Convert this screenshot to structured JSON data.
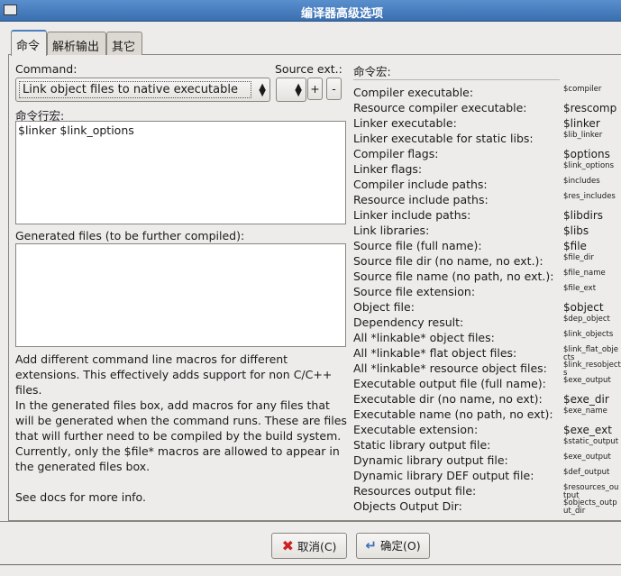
{
  "window": {
    "title": "编译器高级选项"
  },
  "tabs": [
    {
      "label": "命令"
    },
    {
      "label": "解析输出"
    },
    {
      "label": "其它"
    }
  ],
  "command": {
    "label": "Command:",
    "selected": "Link object files to native executable"
  },
  "source_ext": {
    "label": "Source ext.:",
    "add": "+",
    "remove": "-"
  },
  "macro_line": {
    "label": "命令行宏:",
    "value": "$linker $link_options"
  },
  "generated": {
    "label": "Generated files (to be further compiled):",
    "value": ""
  },
  "help": [
    "Add different command line macros for different extensions. This effectively adds support for non C/C++ files.",
    "In the generated files box, add macros for any files that will be generated when the command runs. These are files that will further need to be compiled by the build system.",
    "Currently, only the $file* macros are allowed to appear in the generated files box.",
    "",
    "See docs for more info."
  ],
  "macros": {
    "title": "命令宏:",
    "rows": [
      [
        "Compiler executable:",
        "$compiler"
      ],
      [
        "Resource compiler executable:",
        "$rescomp"
      ],
      [
        "Linker executable:",
        "$linker"
      ],
      [
        "Linker executable for static libs:",
        "$lib_linker"
      ],
      [
        "Compiler flags:",
        "$options"
      ],
      [
        "Linker flags:",
        "$link_options"
      ],
      [
        "Compiler include paths:",
        "$includes"
      ],
      [
        "Resource include paths:",
        "$res_includes"
      ],
      [
        "Linker include paths:",
        "$libdirs"
      ],
      [
        "Link libraries:",
        "$libs"
      ],
      [
        "Source file (full name):",
        "$file"
      ],
      [
        "Source file dir (no name, no ext.):",
        "$file_dir"
      ],
      [
        "Source file name (no path, no ext.):",
        "$file_name"
      ],
      [
        "Source file extension:",
        "$file_ext"
      ],
      [
        "Object file:",
        "$object"
      ],
      [
        "Dependency result:",
        "$dep_object"
      ],
      [
        "All *linkable* object files:",
        "$link_objects"
      ],
      [
        "All *linkable* flat object files:",
        "$link_flat_objects"
      ],
      [
        "All *linkable* resource object files:",
        "$link_resobjects"
      ],
      [
        "Executable output file (full name):",
        "$exe_output"
      ],
      [
        "Executable dir (no name, no ext):",
        "$exe_dir"
      ],
      [
        "Executable name (no path, no ext):",
        "$exe_name"
      ],
      [
        "Executable extension:",
        "$exe_ext"
      ],
      [
        "Static library output file:",
        "$static_output"
      ],
      [
        "Dynamic library output file:",
        "$exe_output"
      ],
      [
        "Dynamic library DEF output file:",
        "$def_output"
      ],
      [
        "Resources output file:",
        "$resources_output"
      ],
      [
        "Objects Output Dir:",
        "$objects_output_dir"
      ]
    ]
  },
  "buttons": {
    "cancel": "取消(C)",
    "ok": "确定(O)"
  },
  "colors": {
    "titlebar": "#3a6fb0",
    "cancel_icon": "#cc2222",
    "ok_icon": "#3a6fb8"
  }
}
